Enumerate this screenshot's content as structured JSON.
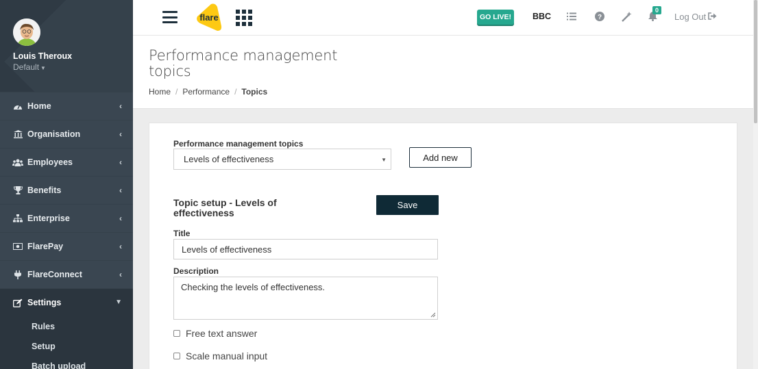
{
  "user": {
    "name": "Louis Theroux",
    "role": "Default"
  },
  "sidebar": {
    "items": [
      {
        "label": "Home",
        "icon": "dashboard-icon"
      },
      {
        "label": "Organisation",
        "icon": "institution-icon"
      },
      {
        "label": "Employees",
        "icon": "users-icon"
      },
      {
        "label": "Benefits",
        "icon": "trophy-icon"
      },
      {
        "label": "Enterprise",
        "icon": "sitemap-icon"
      },
      {
        "label": "FlarePay",
        "icon": "money-icon"
      },
      {
        "label": "FlareConnect",
        "icon": "plug-icon"
      },
      {
        "label": "Settings",
        "icon": "edit-icon"
      }
    ],
    "settings_sub": [
      "Rules",
      "Setup",
      "Batch upload"
    ]
  },
  "topbar": {
    "logo_text": "flare",
    "go_live": "GO LIVE!",
    "company": "BBC",
    "notification_count": "0",
    "logout": "Log Out"
  },
  "page": {
    "title": "Performance management topics",
    "breadcrumb": [
      "Home",
      "Performance",
      "Topics"
    ]
  },
  "form": {
    "topics_label": "Performance management topics",
    "topics_selected": "Levels of effectiveness",
    "add_new": "Add new",
    "section_title": "Topic setup - Levels of effectiveness",
    "save": "Save",
    "title_label": "Title",
    "title_value": "Levels of effectiveness",
    "description_label": "Description",
    "description_value": "Checking the levels of effectiveness.",
    "free_text_label": "Free text answer",
    "scale_manual_label": "Scale manual input"
  },
  "colors": {
    "sidebar_bg": "#3a4651",
    "accent_green": "#26a88f",
    "dark_button": "#0f2a36",
    "logo_yellow": "#fdc913"
  }
}
